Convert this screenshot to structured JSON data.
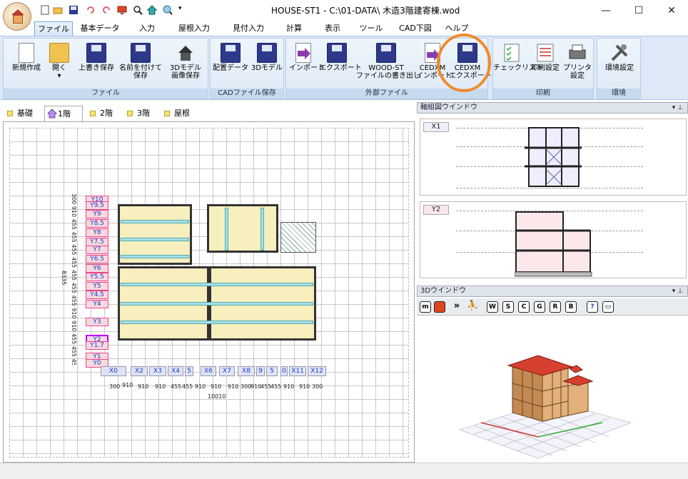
{
  "window": {
    "title": "HOUSE-ST1 - C:\\01-DATA\\ 木造3階建寄棟.wod",
    "minimize": "—",
    "maximize": "☐",
    "close": "✕"
  },
  "ribbon_tabs": [
    "ファイル",
    "基本データ",
    "入力",
    "屋根入力",
    "見付入力",
    "計算",
    "表示",
    "ツール",
    "CAD下図",
    "ヘルプ"
  ],
  "ribbon": {
    "groups": {
      "file": "ファイル",
      "cad_save": "CADファイル保存",
      "external": "外部ファイル",
      "print": "印刷",
      "env": "環境"
    },
    "buttons": {
      "new": "新規作成",
      "open": "開く",
      "open_arrow": "▾",
      "overwrite": "上書き保存",
      "save_as_1": "名前を付けて",
      "save_as_2": "保存",
      "model3d_1": "3Dモデル",
      "model3d_2": "画像保存",
      "layout_data": "配置データ",
      "cad_3d": "3Dモデル",
      "import": "インポート",
      "export": "エクスポート",
      "woodst_1": "WOOD-ST",
      "woodst_2": "ファイルの書き出し",
      "cedxm_imp_1": "CEDXM",
      "cedxm_imp_2": "インポート",
      "cedxm_exp_1": "CEDXM",
      "cedxm_exp_2": "エクスポート",
      "checklist": "チェックリスト",
      "print_settings": "印刷設定",
      "printer_1": "プリンタ",
      "printer_2": "設定",
      "env_settings": "環境設定"
    }
  },
  "floor_tabs": [
    "基礎",
    "1階",
    "2階",
    "3階",
    "屋根"
  ],
  "plan": {
    "y_labels": [
      "Y10",
      "Y9.5",
      "Y9",
      "Y8.5",
      "Y8",
      "Y7.5",
      "Y7",
      "Y6.5",
      "Y6",
      "Y5.5",
      "Y5",
      "Y4.5",
      "Y4",
      "Y3",
      "Y2",
      "Y1.7",
      "Y1",
      "Y0"
    ],
    "x_labels": [
      "X0",
      "X2",
      "X3",
      "X4",
      "5",
      "X6",
      "X7",
      "X8",
      "9",
      "5",
      "0",
      "X11",
      "X12"
    ],
    "x_dims": [
      "300",
      "910",
      "910",
      "910",
      "455",
      "455",
      "910",
      "910",
      "910",
      "300",
      "910",
      "455",
      "455",
      "910",
      "910",
      "300"
    ],
    "x_total": "10010",
    "y_total": "8335",
    "y_dims_text": "300 910 455 455 455 455 455 455 455 910 910 455 455 455 910 910 300"
  },
  "axis_window": {
    "title": "軸組図ウインドウ",
    "x_tag": "X1",
    "y_tag": "Y2"
  },
  "window_3d": {
    "title": "3Dウインドウ",
    "buttons": [
      "W",
      "S",
      "C",
      "G",
      "R",
      "B"
    ],
    "help": "?"
  },
  "colors": {
    "accent": "#f28a2a",
    "ribbon_bg": "#dde9f6",
    "roof": "#d64030",
    "wall_fill": "#f7efbe",
    "beam": "#a6e0ea"
  }
}
